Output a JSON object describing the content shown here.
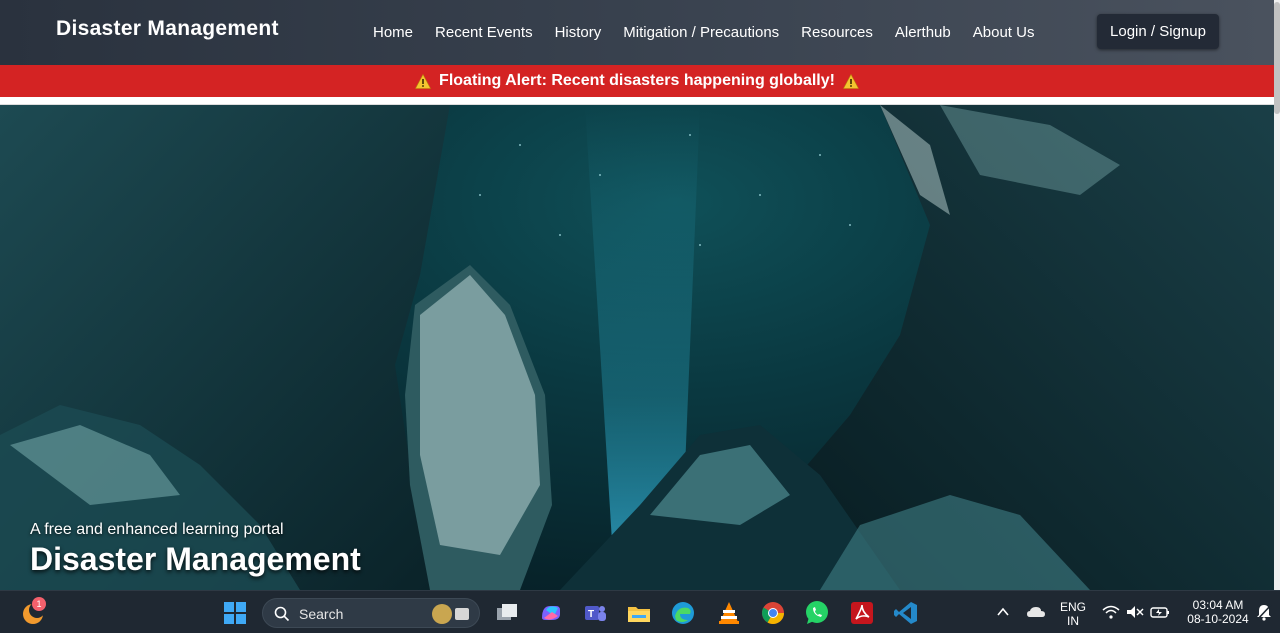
{
  "nav": {
    "brand": "Disaster Management",
    "links": [
      "Home",
      "Recent Events",
      "History",
      "Mitigation / Precautions",
      "Resources",
      "Alerthub",
      "About Us"
    ],
    "login_label": "Login / Signup"
  },
  "alert": {
    "text": "Floating Alert: Recent disasters happening globally!",
    "color": "#d42323"
  },
  "hero": {
    "subtitle": "A free and enhanced learning portal",
    "title": "Disaster Management"
  },
  "taskbar": {
    "search_placeholder": "Search",
    "notification_badge": "1",
    "language_line1": "ENG",
    "language_line2": "IN",
    "time": "03:04 AM",
    "date": "08-10-2024",
    "apps": [
      "widgets-icon",
      "windows-start-icon",
      "task-view-icon",
      "copilot-icon",
      "teams-icon",
      "file-explorer-icon",
      "edge-icon",
      "vlc-icon",
      "chrome-icon",
      "whatsapp-icon",
      "acrobat-icon",
      "vscode-icon"
    ]
  }
}
